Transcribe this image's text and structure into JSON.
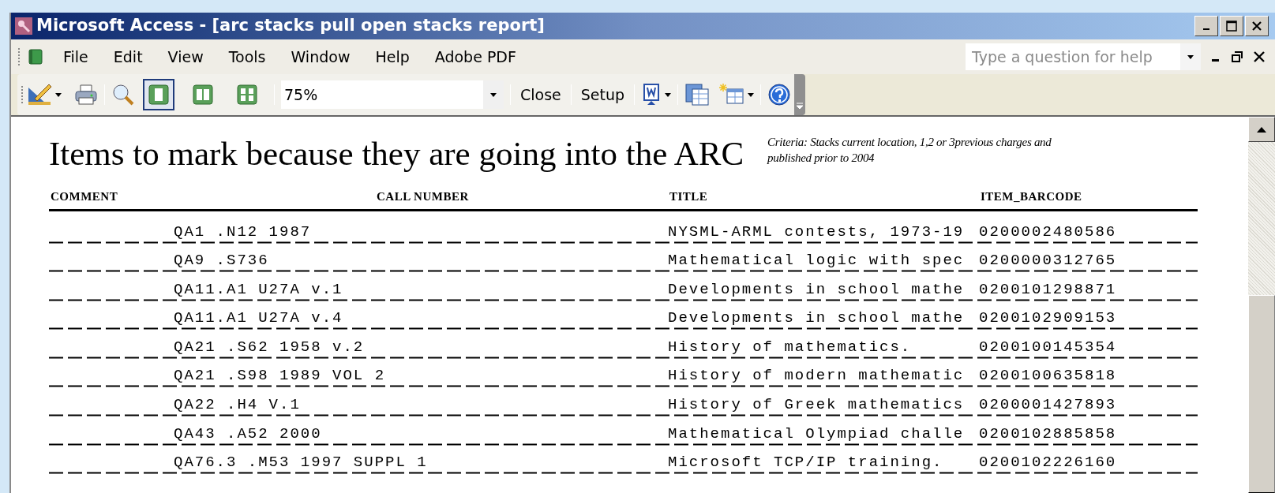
{
  "window": {
    "title": "Microsoft Access - [arc stacks pull open stacks report]"
  },
  "menu": [
    {
      "label": "File"
    },
    {
      "label": "Edit"
    },
    {
      "label": "View"
    },
    {
      "label": "Tools"
    },
    {
      "label": "Window"
    },
    {
      "label": "Help"
    },
    {
      "label": "Adobe PDF"
    }
  ],
  "help_box": {
    "placeholder": "Type a question for help"
  },
  "toolbar": {
    "view_buttons": [
      {
        "kind": "one-page",
        "selected": true
      },
      {
        "kind": "two-pages",
        "selected": false
      },
      {
        "kind": "multiple-pages",
        "selected": false
      }
    ],
    "zoom": "75%",
    "buttons": [
      {
        "label": "Close"
      },
      {
        "label": "Setup"
      }
    ]
  },
  "report": {
    "heading": "Items to mark because they are going into the ARC",
    "criteria": "Criteria: Stacks current location, 1,2 or 3previous charges and published prior to 2004",
    "columns": [
      "COMMENT",
      "CALL NUMBER",
      "TITLE",
      "ITEM_BARCODE"
    ],
    "rows": [
      {
        "call_number": "QA1 .N12 1987",
        "title": "NYSML-ARML contests, 1973-19",
        "barcode": "0200002480586"
      },
      {
        "call_number": "QA9 .S736",
        "title": "Mathematical logic with spec",
        "barcode": "0200000312765"
      },
      {
        "call_number": "QA11.A1 U27A v.1",
        "title": "Developments in school mathe",
        "barcode": "0200101298871"
      },
      {
        "call_number": "QA11.A1 U27A v.4",
        "title": "Developments in school mathe",
        "barcode": "0200102909153"
      },
      {
        "call_number": "QA21 .S62 1958 v.2",
        "title": "History of mathematics.",
        "barcode": "0200100145354"
      },
      {
        "call_number": "QA21 .S98 1989 VOL 2",
        "title": "History of modern mathematic",
        "barcode": "0200100635818"
      },
      {
        "call_number": "QA22 .H4 V.1",
        "title": "History of Greek mathematics",
        "barcode": "0200001427893"
      },
      {
        "call_number": "QA43 .A52 2000",
        "title": "Mathematical Olympiad challe",
        "barcode": "0200102885858"
      },
      {
        "call_number": "QA76.3 .M53 1997 SUPPL 1",
        "title": "Microsoft TCP/IP training.",
        "barcode": "0200102226160"
      }
    ]
  }
}
